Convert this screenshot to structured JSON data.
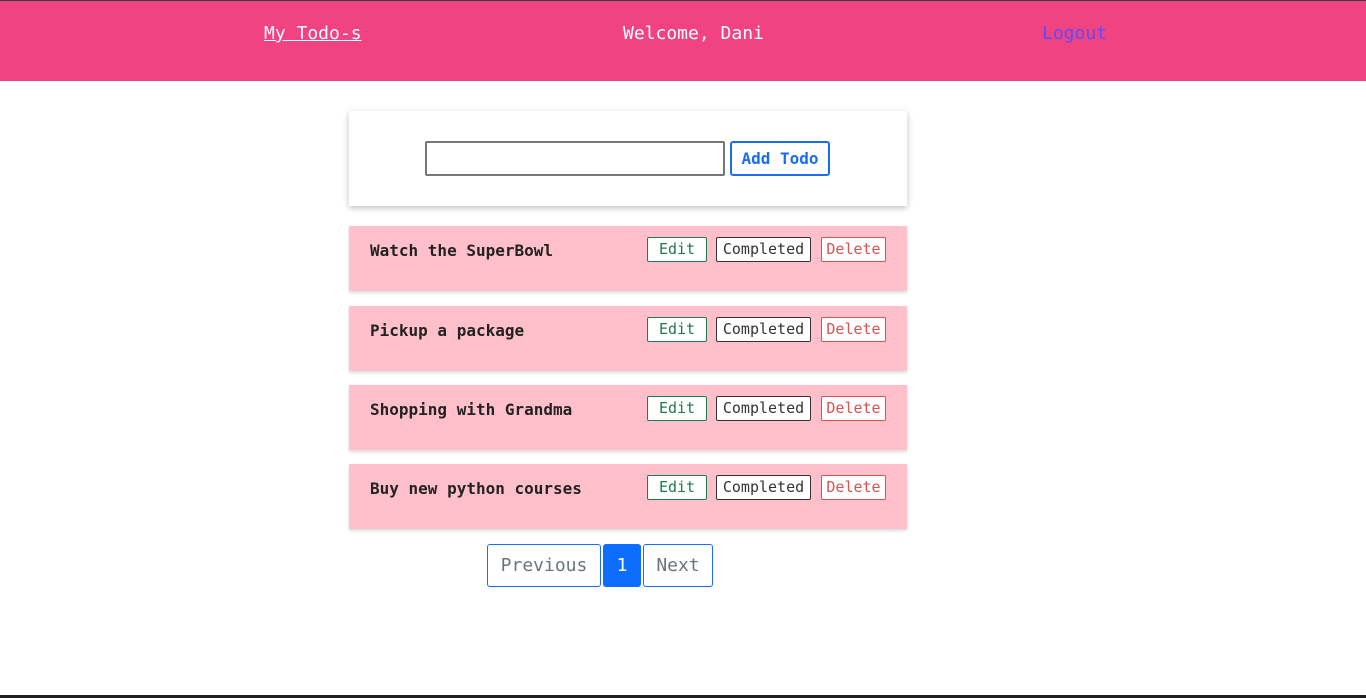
{
  "header": {
    "brand": "My Todo-s",
    "welcome": "Welcome, Dani",
    "logout": "Logout"
  },
  "add_form": {
    "input_value": "",
    "button_label": "Add Todo"
  },
  "todos": [
    {
      "text": "Watch the SuperBowl",
      "edit": "Edit",
      "completed": "Completed",
      "delete": "Delete"
    },
    {
      "text": "Pickup a package",
      "edit": "Edit",
      "completed": "Completed",
      "delete": "Delete"
    },
    {
      "text": "Shopping with Grandma",
      "edit": "Edit",
      "completed": "Completed",
      "delete": "Delete"
    },
    {
      "text": "Buy new python courses",
      "edit": "Edit",
      "completed": "Completed",
      "delete": "Delete"
    }
  ],
  "pagination": {
    "previous": "Previous",
    "current_page": "1",
    "next": "Next"
  },
  "colors": {
    "header_bg": "#f14281",
    "todo_bg": "#ffc0cb",
    "accent": "#0d6efd"
  }
}
